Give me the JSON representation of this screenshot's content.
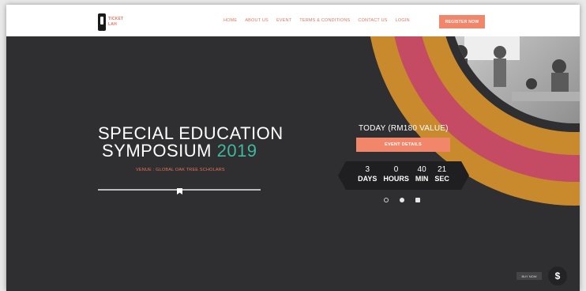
{
  "header": {
    "logo": {
      "word1": "TICKET",
      "word2": "LAH"
    },
    "nav": [
      "HOME",
      "ABOUT US",
      "EVENT",
      "TERMS & CONDITIONS",
      "CONTACT US",
      "LOGIN"
    ],
    "register_label": "REGISTER NOW"
  },
  "hero": {
    "title_line1": "SPECIAL EDUCATION",
    "title_line2": "SYMPOSIUM",
    "title_year": "2019",
    "venue": "VENUE : GLOBAL OAK TREE SCHOLARS"
  },
  "panel": {
    "today": "TODAY (RM180 VALUE)",
    "event_button": "EVENT DETAILS",
    "countdown": [
      {
        "value": "3",
        "label": "DAYS"
      },
      {
        "value": "0",
        "label": "HOURS"
      },
      {
        "value": "40",
        "label": "MIN"
      },
      {
        "value": "21",
        "label": "SEC"
      }
    ]
  },
  "footer": {
    "buy_now": "BUY NOW",
    "dollar": "$"
  },
  "colors": {
    "accent": "#f2866a",
    "teal": "#3fb8a0",
    "arc_gold": "#c98a2e",
    "arc_pink": "#c54a63",
    "background": "#2f2f31"
  },
  "icons": [
    "slider-handle-icon",
    "dollar-icon"
  ]
}
